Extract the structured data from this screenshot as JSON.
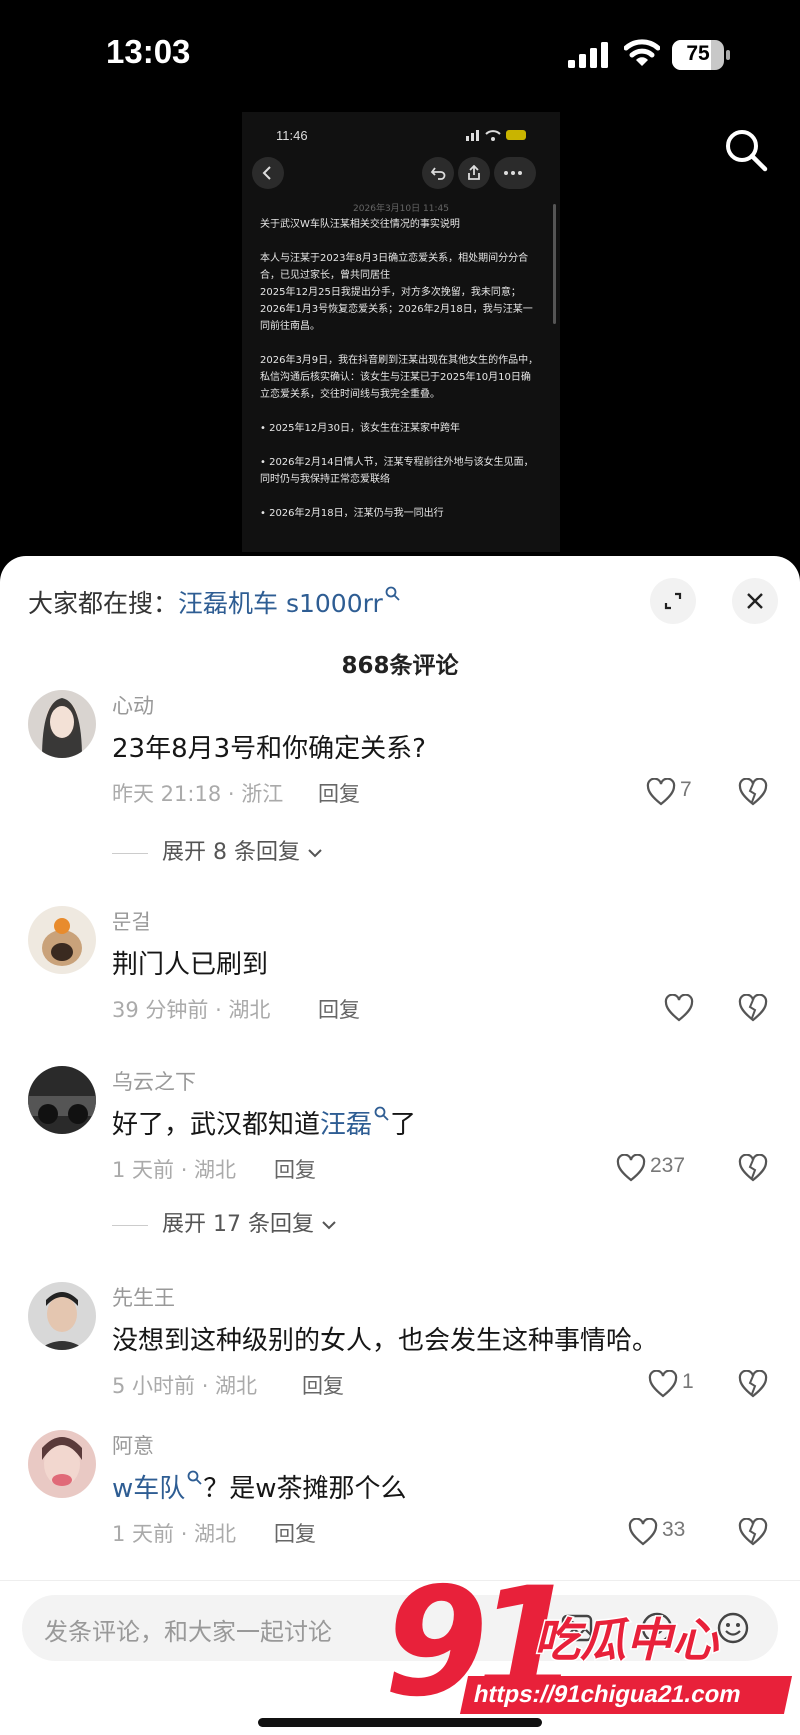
{
  "status_bar": {
    "time": "13:03",
    "battery": "75",
    "battery_level": 0.75
  },
  "embedded_screenshot": {
    "time": "11:46",
    "date": "2026年3月10日 11:45",
    "text": "关于武汉W车队汪某相关交往情况的事实说明\n\n本人与汪某于2023年8月3日确立恋爱关系，相处期间分分合合，已见过家长，曾共同居住\n2025年12月25日我提出分手，对方多次挽留，我未同意；2026年1月3号恢复恋爱关系；2026年2月18日，我与汪某一同前往南昌。\n\n2026年3月9日，我在抖音刷到汪某出现在其他女生的作品中，私信沟通后核实确认：该女生与汪某已于2025年10月10日确立恋爱关系，交往时间线与我完全重叠。\n\n• 2025年12月30日，该女生在汪某家中跨年\n\n• 2026年2月14日情人节，汪某专程前往外地与该女生见面，同时仍与我保持正常恋爱联络\n\n• 2026年2月18日，汪某仍与我一同出行"
  },
  "sheet": {
    "search_prefix": "大家都在搜：",
    "search_term": "汪磊机车 s1000rr",
    "comment_count": "868条评论"
  },
  "comments": [
    {
      "name": "心动",
      "text": "23年8月3号和你确定关系?",
      "meta": "昨天 21:18 · 浙江",
      "reply": "回复",
      "likes": "7",
      "expand": "展开 8 条回复"
    },
    {
      "name": "문걸",
      "text": "荆门人已刷到",
      "meta": "39 分钟前 · 湖北",
      "reply": "回复",
      "likes": ""
    },
    {
      "name": "乌云之下",
      "text_before": "好了，武汉都知道",
      "text_link": "汪磊",
      "text_after": "了",
      "meta": "1 天前 · 湖北",
      "reply": "回复",
      "likes": "237",
      "expand": "展开 17 条回复"
    },
    {
      "name": "先生王",
      "text": "没想到这种级别的女人，也会发生这种事情哈。",
      "meta": "5 小时前 · 湖北",
      "reply": "回复",
      "likes": "1"
    },
    {
      "name": "阿意",
      "text_link": "w车队",
      "text_after": "？是w茶摊那个么",
      "meta": "1 天前 · 湖北",
      "reply": "回复",
      "likes": "33"
    }
  ],
  "input": {
    "placeholder": "发条评论，和大家一起讨论"
  },
  "watermark": {
    "logo_number": "91",
    "logo_text": "吃瓜中心",
    "url": "https://91chigua21.com"
  }
}
